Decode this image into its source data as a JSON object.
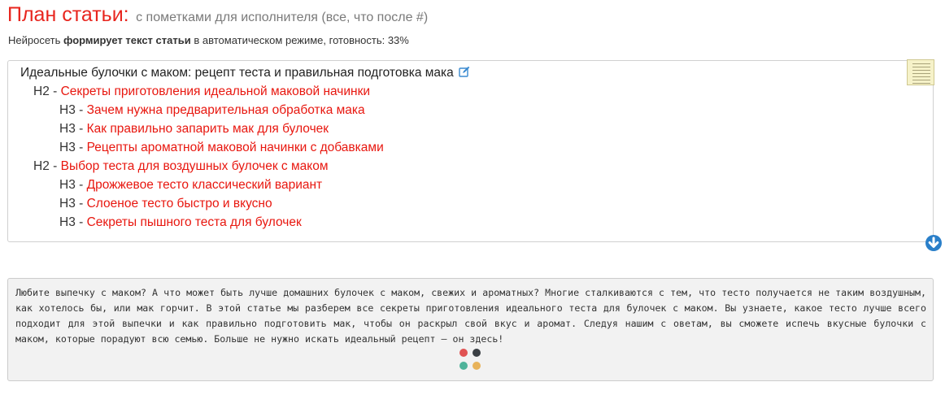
{
  "header": {
    "title": "План статьи:",
    "subtitle": "с пометками для исполнителя (все, что после #)"
  },
  "status": {
    "prefix": "Нейросеть",
    "bold": "формирует текст статьи",
    "suffix": "в автоматическом режиме, готовность: 33%",
    "progress_percent": 33
  },
  "outline": {
    "h1": "Идеальные булочки с маком: рецепт теста и правильная подготовка мака",
    "rows": [
      {
        "level": "H2",
        "sep": " - ",
        "text": "Секреты приготовления идеальной маковой начинки"
      },
      {
        "level": "H3",
        "sep": " - ",
        "text": "Зачем нужна предварительная обработка мака"
      },
      {
        "level": "H3",
        "sep": " - ",
        "text": "Как правильно запарить мак для булочек"
      },
      {
        "level": "H3",
        "sep": " - ",
        "text": "Рецепты ароматной маковой начинки с добавками"
      },
      {
        "level": "H2",
        "sep": " - ",
        "text": "Выбор теста для воздушных булочек с маком"
      },
      {
        "level": "H3",
        "sep": " - ",
        "text": "Дрожжевое тесто классический вариант"
      },
      {
        "level": "H3",
        "sep": " - ",
        "text": "Слоеное тесто быстро и вкусно"
      },
      {
        "level": "H3",
        "sep": " - ",
        "text": "Секреты пышного теста для булочек"
      }
    ]
  },
  "article": {
    "text": "Любите выпечку с маком? А что может быть лучше домашних булочек с маком, свежих и ароматных? Многие сталкиваются с тем, что тесто получается не таким воздушным, как хотелось бы, или мак горчит. В этой статье мы разберем все секреты приготовления идеального теста для булочек с маком. Вы узнаете, какое тесто лучше всего подходит для этой выпечки и как правильно подготовить мак, чтобы он раскрыл свой вкус и аромат. Следуя нашим с оветам, вы сможете испечь вкусные булочки с маком, которые порадуют всю семью. Больше не нужно искать идеальный рецепт – он здесь!"
  },
  "icons": {
    "edit": "edit-icon",
    "note": "note-thumbnail-icon",
    "scroll_down": "arrow-down-circle-icon"
  },
  "colors": {
    "accent_red": "#e8251e",
    "link_red": "#e8170f",
    "button_blue": "#2a7fc9",
    "loader_dots": [
      "#e05252",
      "#3a3f44",
      "#4fb39a",
      "#e8b35a"
    ]
  }
}
